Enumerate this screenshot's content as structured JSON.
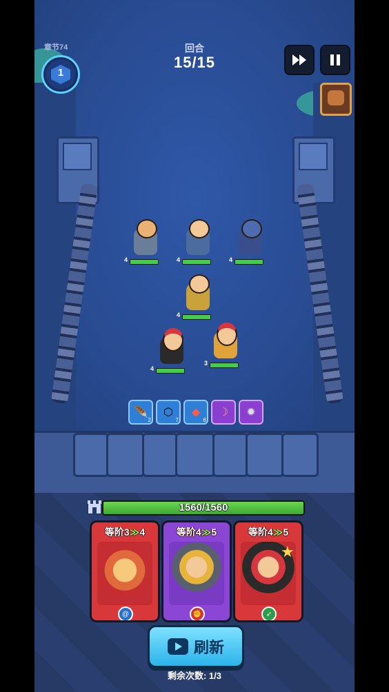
{
  "hud": {
    "chapter_label": "章节74",
    "level_badge": "1",
    "round_label": "回合",
    "round_value": "15/15",
    "fast_forward_icon": "fast-forward-icon",
    "pause_icon": "pause-icon"
  },
  "units": [
    {
      "id": "viking-dwarf",
      "level": "4",
      "hp": 1.0,
      "color": "#6b7e99"
    },
    {
      "id": "armored-knight",
      "level": "4",
      "hp": 1.0,
      "color": "#4d6c9e"
    },
    {
      "id": "minotaur-warrior",
      "level": "4",
      "hp": 1.0,
      "color": "#3a4e8e"
    },
    {
      "id": "golden-knight",
      "level": "4",
      "hp": 1.0,
      "color": "#caa23c"
    },
    {
      "id": "red-hair-fighter",
      "level": "4",
      "hp": 1.0,
      "color": "#2a2a2a"
    },
    {
      "id": "fire-dancer",
      "level": "3",
      "hp": 1.0,
      "color": "#e0a33a"
    }
  ],
  "skills": [
    {
      "icon": "feather-icon",
      "count": "2",
      "bg": "#2f7fd6"
    },
    {
      "icon": "shield-ring-icon",
      "count": "7",
      "bg": "#2f7fd6"
    },
    {
      "icon": "ruby-amulet-icon",
      "count": "6",
      "bg": "#2f7fd6"
    },
    {
      "icon": "claw-icon",
      "count": "",
      "bg": "#8a3fd1"
    },
    {
      "icon": "spiked-shield-icon",
      "count": "",
      "bg": "#8a3fd1"
    }
  ],
  "base": {
    "hp_text": "1560/1560",
    "hp_fraction": 1.0
  },
  "cards": [
    {
      "tier_prefix": "等阶3",
      "tier_next": "4",
      "bg": "#d9383a",
      "trait_icon": "swirl-icon",
      "trait_bg": "#2a6fc7",
      "starred": false
    },
    {
      "tier_prefix": "等阶4",
      "tier_next": "5",
      "bg": "#8b46d6",
      "trait_icon": "fist-icon",
      "trait_bg": "#d5333b",
      "starred": false
    },
    {
      "tier_prefix": "等阶4",
      "tier_next": "5",
      "bg": "#d9383a",
      "trait_icon": "bow-icon",
      "trait_bg": "#2e9c4a",
      "starred": true
    }
  ],
  "refresh": {
    "label": "刷新",
    "remaining": "剩余次数: 1/3"
  }
}
